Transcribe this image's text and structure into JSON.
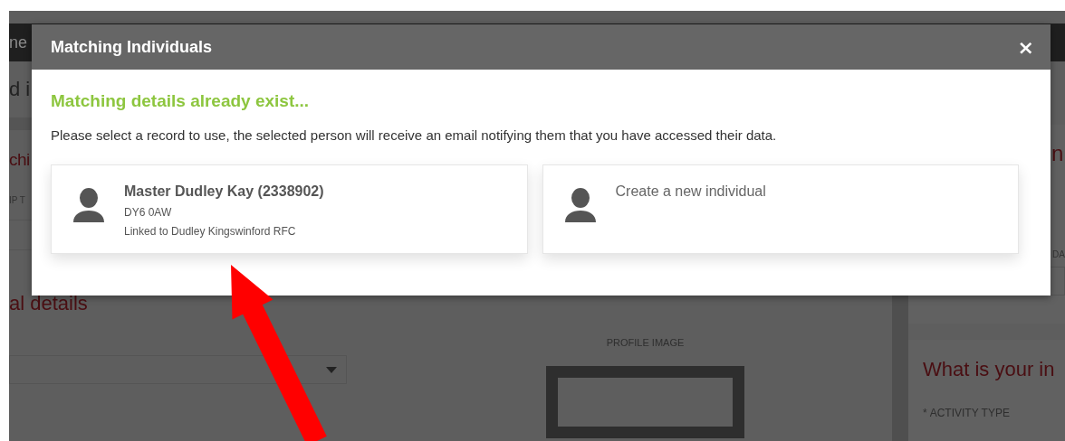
{
  "background_page": {
    "nav_text": "ne",
    "heading": "d i",
    "section": {
      "heading": "chi",
      "label": "IP T"
    },
    "personal_details": {
      "heading": "al details"
    },
    "profile_image": {
      "label": "PROFILE IMAGE"
    },
    "side_panel_1": {
      "heading": "n",
      "label": "DA"
    },
    "side_panel_2": {
      "heading": "What is your in",
      "required_mark": "*",
      "field_label": "ACTIVITY TYPE"
    }
  },
  "dialog": {
    "title": "Matching Individuals",
    "close": "×",
    "heading": "Matching details already exist...",
    "message": "Please select a record to use, the selected person will receive an email notifying them that you have accessed their data.",
    "records": [
      {
        "kind": "match",
        "name": "Master Dudley Kay (2338902)",
        "postcode": "DY6 0AW",
        "link": "Linked to Dudley Kingswinford RFC"
      },
      {
        "kind": "new",
        "name": "Create a new individual"
      }
    ]
  }
}
